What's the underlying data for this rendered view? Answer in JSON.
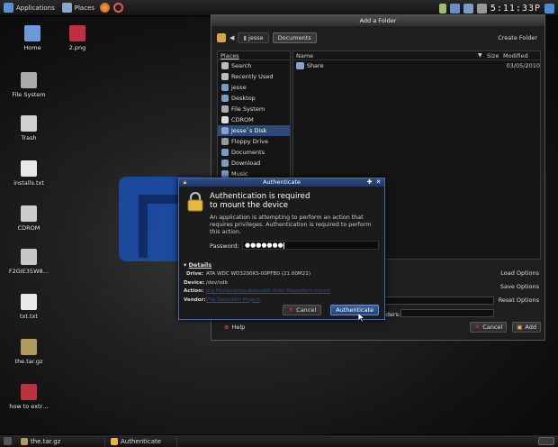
{
  "top_panel": {
    "applications": "Applications",
    "places": "Places",
    "clock": "5:11:33P"
  },
  "desktop_icons": [
    {
      "label": "Home",
      "color": "#6a9ad8"
    },
    {
      "label": "2.png",
      "color": "#c03040"
    },
    {
      "label": "File System",
      "color": "#aaaaaa"
    },
    {
      "label": "Trash",
      "color": "#d0d0d0"
    },
    {
      "label": "installs.txt",
      "color": "#e8e8e8"
    },
    {
      "label": "CDROM",
      "color": "#cccccc"
    },
    {
      "label": "F2GIE35W8…",
      "color": "#c8c8c8"
    },
    {
      "label": "txt.txt",
      "color": "#e8e8e8"
    },
    {
      "label": "the.tar.gz",
      "color": "#b09a60"
    },
    {
      "label": "how to extr…",
      "color": "#c03040"
    }
  ],
  "folder_window": {
    "title": "Add a Folder",
    "crumb_user": "jesse",
    "crumb_current": "Documents",
    "create_folder": "Create Folder",
    "places_header": "Places",
    "places": [
      "Search",
      "Recently Used",
      "jesse",
      "Desktop",
      "File System",
      "CDROM",
      "Jesse`s Disk",
      "Floppy Drive",
      "Documents",
      "Download",
      "Music"
    ],
    "selected_place": "Jesse`s Disk",
    "columns": {
      "name": "Name",
      "size": "Size",
      "modified": "Modified"
    },
    "files": [
      {
        "name": "Share",
        "size": "",
        "modified": "03/05/2010"
      }
    ],
    "load_options": "Load Options",
    "save_options": "Save Options",
    "reset_options": "Reset Options",
    "folders_label": "lders:",
    "help": "Help",
    "cancel": "Cancel",
    "add": "Add"
  },
  "auth_dialog": {
    "title": "Authenticate",
    "heading_line1": "Authentication is required",
    "heading_line2": "to mount the device",
    "description": "An application is attempting to perform an action that requires privileges. Authentication is required to perform this action.",
    "password_label": "Password:",
    "password_value": "●●●●●●●",
    "details_label": "Details",
    "drive_key": "Drive:",
    "drive_value": "ATA WDC WD3200KS-00PFB0 (21.00M21)",
    "device_key": "Device:",
    "device_value": "/dev/sdb",
    "action_key": "Action:",
    "action_value": "org.freedesktop.devicekit.disks.filesystem-mount",
    "vendor_key": "Vendor:",
    "vendor_value": "The DeviceKit Project",
    "cancel": "Cancel",
    "authenticate": "Authenticate"
  },
  "taskbar": {
    "items": [
      "the.tar.gz",
      "Authenticate"
    ]
  }
}
